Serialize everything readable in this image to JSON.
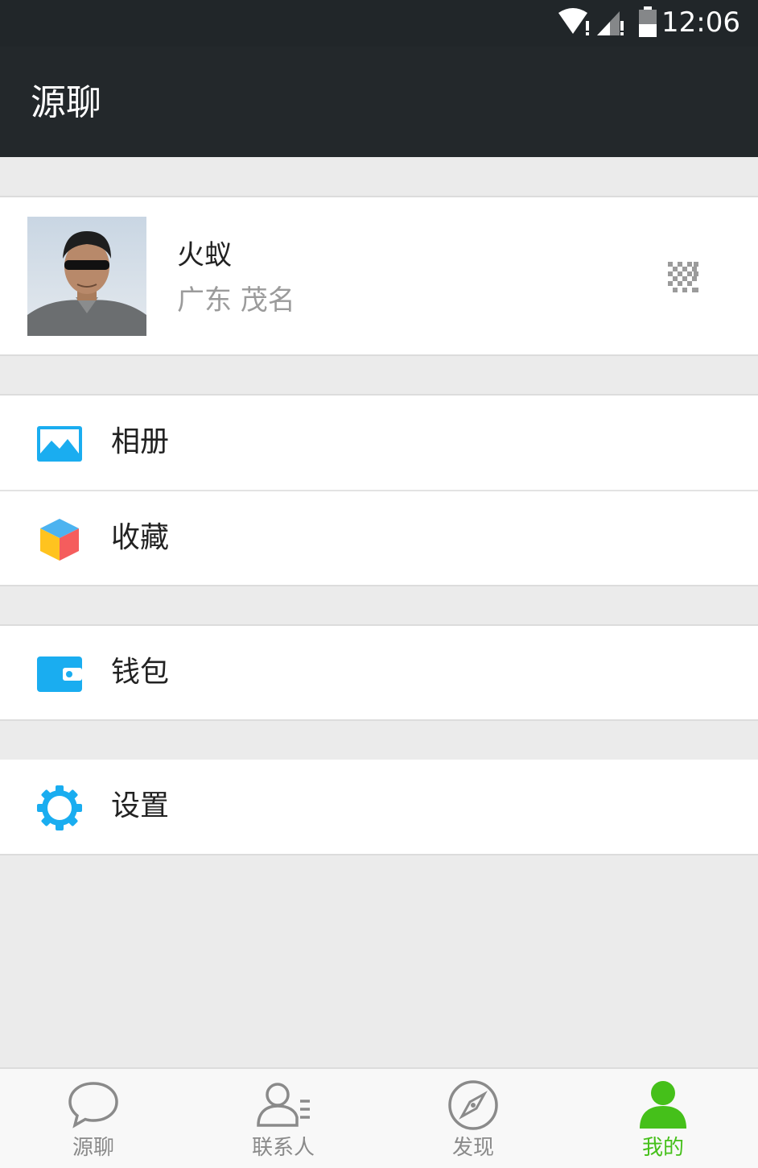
{
  "status_bar": {
    "time": "12:06"
  },
  "app_bar": {
    "title": "源聊"
  },
  "profile": {
    "name": "火蚁",
    "location": "广东 茂名"
  },
  "menu": [
    {
      "label": "相册",
      "icon": "album-icon",
      "color": "#1aadf0"
    },
    {
      "label": "收藏",
      "icon": "favorites-cube-icon",
      "color": "#1aadf0"
    },
    {
      "label": "钱包",
      "icon": "wallet-icon",
      "color": "#1aadf0"
    },
    {
      "label": "设置",
      "icon": "settings-gear-icon",
      "color": "#1aadf0"
    }
  ],
  "tabs": [
    {
      "label": "源聊",
      "icon": "chat-bubble-icon",
      "active": false
    },
    {
      "label": "联系人",
      "icon": "contacts-icon",
      "active": false
    },
    {
      "label": "发现",
      "icon": "compass-icon",
      "active": false
    },
    {
      "label": "我的",
      "icon": "person-icon",
      "active": true
    }
  ],
  "colors": {
    "accent": "#45c01a",
    "icon_blue": "#1aadf0",
    "app_bar": "#23282b"
  }
}
